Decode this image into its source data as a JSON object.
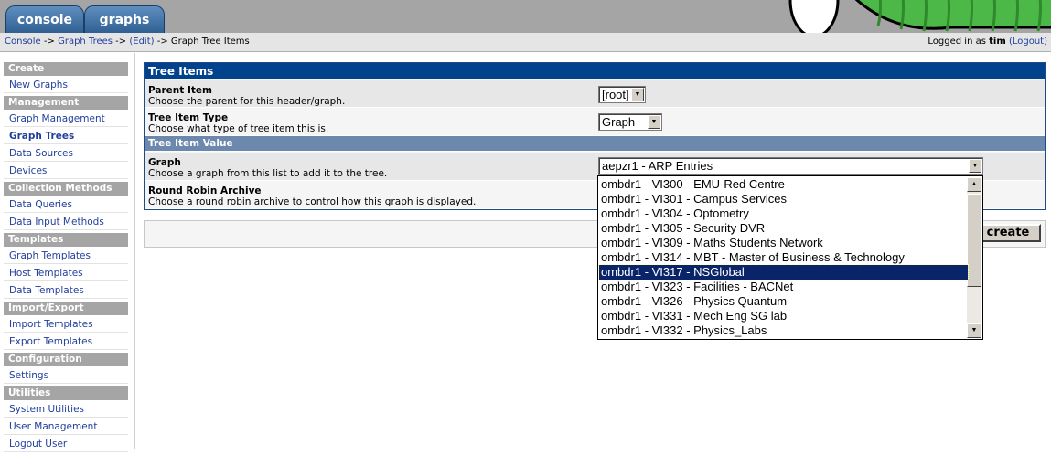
{
  "tabs": {
    "console": "console",
    "graphs": "graphs"
  },
  "breadcrumb": {
    "items": [
      "Console",
      "Graph Trees",
      "(Edit)",
      "Graph Tree Items"
    ],
    "separator": "->"
  },
  "login": {
    "prefix": "Logged in as",
    "user": "tim",
    "logout": "(Logout)"
  },
  "sidebar": [
    {
      "type": "header",
      "label": "Create"
    },
    {
      "type": "link",
      "label": "New Graphs"
    },
    {
      "type": "header",
      "label": "Management"
    },
    {
      "type": "link",
      "label": "Graph Management"
    },
    {
      "type": "link",
      "label": "Graph Trees",
      "active": true
    },
    {
      "type": "link",
      "label": "Data Sources"
    },
    {
      "type": "link",
      "label": "Devices"
    },
    {
      "type": "header",
      "label": "Collection Methods"
    },
    {
      "type": "link",
      "label": "Data Queries"
    },
    {
      "type": "link",
      "label": "Data Input Methods"
    },
    {
      "type": "header",
      "label": "Templates"
    },
    {
      "type": "link",
      "label": "Graph Templates"
    },
    {
      "type": "link",
      "label": "Host Templates"
    },
    {
      "type": "link",
      "label": "Data Templates"
    },
    {
      "type": "header",
      "label": "Import/Export"
    },
    {
      "type": "link",
      "label": "Import Templates"
    },
    {
      "type": "link",
      "label": "Export Templates"
    },
    {
      "type": "header",
      "label": "Configuration"
    },
    {
      "type": "link",
      "label": "Settings"
    },
    {
      "type": "header",
      "label": "Utilities"
    },
    {
      "type": "link",
      "label": "System Utilities"
    },
    {
      "type": "link",
      "label": "User Management"
    },
    {
      "type": "link",
      "label": "Logout User"
    }
  ],
  "panel": {
    "title": "Tree Items",
    "parent": {
      "label": "Parent Item",
      "desc": "Choose the parent for this header/graph.",
      "value": "[root]"
    },
    "type": {
      "label": "Tree Item Type",
      "desc": "Choose what type of tree item this is.",
      "value": "Graph"
    },
    "value_header": "Tree Item Value",
    "graph": {
      "label": "Graph",
      "desc": "Choose a graph from this list to add it to the tree.",
      "value": "aepzr1 - ARP Entries"
    },
    "rra": {
      "label": "Round Robin Archive",
      "desc": "Choose a round robin archive to control how this graph is displayed."
    }
  },
  "create_button": "create",
  "dropdown": {
    "options": [
      "ombdr1 - VI300 - EMU-Red Centre",
      "ombdr1 - VI301 - Campus Services",
      "ombdr1 - VI304 - Optometry",
      "ombdr1 - VI305 - Security DVR",
      "ombdr1 - VI309 - Maths Students Network",
      "ombdr1 - VI314 - MBT - Master of Business & Technology",
      "ombdr1 - VI317 - NSGlobal",
      "ombdr1 - VI323 - Facilities - BACNet",
      "ombdr1 - VI326 - Physics Quantum",
      "ombdr1 - VI331 - Mech Eng SG lab",
      "ombdr1 - VI332 - Physics_Labs"
    ],
    "highlighted_index": 6
  },
  "colors": {
    "panel_title_bg": "#00438c",
    "section_bg": "#6d88ad",
    "link": "#213e9c",
    "sidebar_header_bg": "#a5a5a5",
    "highlight": "#0a246a"
  }
}
